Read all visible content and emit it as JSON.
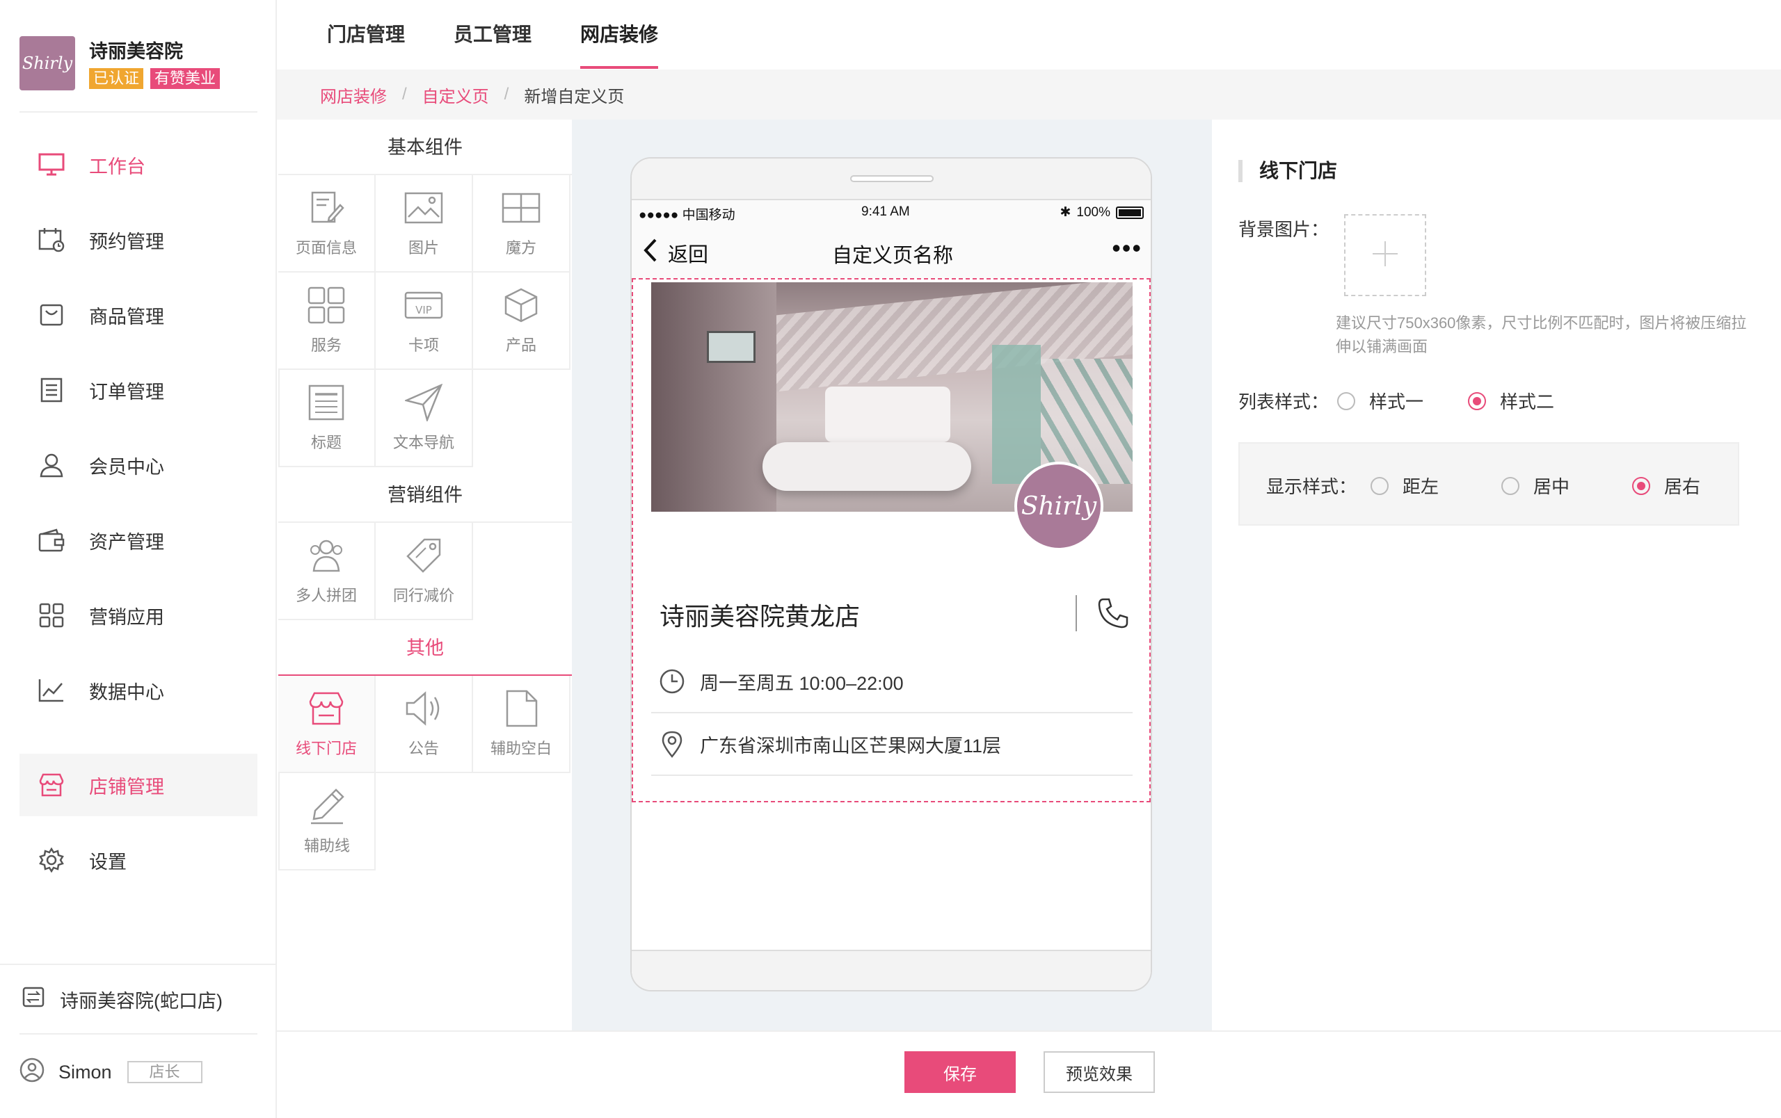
{
  "brand": {
    "logo_text": "Shirly",
    "name": "诗丽美容院",
    "badge_verified": "已认证",
    "badge_partner": "有赞美业"
  },
  "sidebar": {
    "items": [
      {
        "label": "工作台",
        "icon": "monitor-icon"
      },
      {
        "label": "预约管理",
        "icon": "calendar-clock-icon"
      },
      {
        "label": "商品管理",
        "icon": "bag-icon"
      },
      {
        "label": "订单管理",
        "icon": "list-icon"
      },
      {
        "label": "会员中心",
        "icon": "user-icon"
      },
      {
        "label": "资产管理",
        "icon": "wallet-icon"
      },
      {
        "label": "营销应用",
        "icon": "grid-icon"
      },
      {
        "label": "数据中心",
        "icon": "chart-icon"
      },
      {
        "label": "店铺管理",
        "icon": "store-icon"
      },
      {
        "label": "设置",
        "icon": "gear-icon"
      }
    ],
    "store_switch": "诗丽美容院(蛇口店)",
    "user_name": "Simon",
    "user_role": "店长"
  },
  "topnav": {
    "tabs": [
      "门店管理",
      "员工管理",
      "网店装修"
    ]
  },
  "breadcrumb": {
    "level1": "网店装修",
    "level2": "自定义页",
    "current": "新增自定义页",
    "sep": "/"
  },
  "palette": {
    "basic_title": "基本组件",
    "basic": [
      "页面信息",
      "图片",
      "魔方",
      "服务",
      "卡项",
      "产品",
      "标题",
      "文本导航"
    ],
    "marketing_title": "营销组件",
    "marketing": [
      "多人拼团",
      "同行减价"
    ],
    "other_title": "其他",
    "other": [
      "线下门店",
      "公告",
      "辅助空白",
      "辅助线"
    ]
  },
  "phone": {
    "carrier": "●●●●● 中国移动",
    "time": "9:41 AM",
    "battery": "100%",
    "back": "返回",
    "title": "自定义页名称",
    "more": "•••",
    "shop_logo": "Shirly",
    "shop_name": "诗丽美容院黄龙店",
    "hours": "周一至周五   10:00–22:00",
    "address": "广东省深圳市南山区芒果网大厦11层"
  },
  "settings": {
    "section_title": "线下门店",
    "bg_label": "背景图片：",
    "bg_hint": "建议尺寸750x360像素，尺寸比例不匹配时，图片将被压缩拉伸以铺满画面",
    "list_label": "列表样式：",
    "list_opt1": "样式一",
    "list_opt2": "样式二",
    "display_label": "显示样式：",
    "display_left": "距左",
    "display_center": "居中",
    "display_right": "居右"
  },
  "footer": {
    "save": "保存",
    "preview": "预览效果"
  },
  "colors": {
    "accent": "#e84b7a",
    "brand": "#a97a98",
    "badge_orange": "#f0a630"
  }
}
